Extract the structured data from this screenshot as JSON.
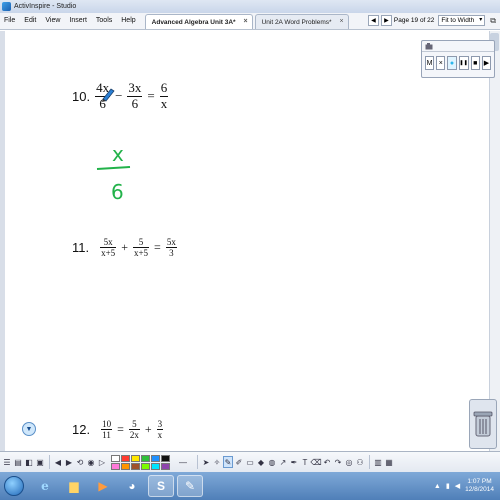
{
  "window": {
    "title": "ActivInspire - Studio"
  },
  "menu": [
    "File",
    "Edit",
    "View",
    "Insert",
    "Tools",
    "Help"
  ],
  "tabs": [
    {
      "label": "Advanced Algebra Unit 3A*",
      "active": true
    },
    {
      "label": "Unit 2A Word Problems*",
      "active": false
    }
  ],
  "pager": {
    "page_text": "Page 19 of 22",
    "fit": "Fit to Width"
  },
  "problems": {
    "p10": {
      "num": "10.",
      "t1": {
        "num": "4x",
        "den": "6"
      },
      "op1": "−",
      "t2": {
        "num": "3x",
        "den": "6"
      },
      "op2": "=",
      "t3": {
        "num": "6",
        "den": "x"
      }
    },
    "p11": {
      "num": "11.",
      "t1": {
        "num": "5x",
        "den": "x+5"
      },
      "op1": "+",
      "t2": {
        "num": "5",
        "den": "x+5"
      },
      "op2": "=",
      "t3": {
        "num": "5x",
        "den": "3"
      }
    },
    "p12": {
      "num": "12.",
      "t1": {
        "num": "10",
        "den": "11"
      },
      "op1": "=",
      "t2": {
        "num": "5",
        "den": "2x"
      },
      "op2": "+",
      "t3": {
        "num": "3",
        "den": "x"
      }
    }
  },
  "handwriting": {
    "num": "x",
    "den": "6",
    "color": "#22b24a"
  },
  "mini_toolbar": {
    "buttons": [
      "M",
      "×",
      "●",
      "❚❚",
      "■",
      "▶"
    ]
  },
  "palette": [
    "#ffffff",
    "#ff3b30",
    "#ffe600",
    "#2fbf3a",
    "#1e90ff",
    "#111111",
    "#ff7ad9",
    "#ff9500",
    "#a0522d",
    "#7cfc00",
    "#00e5ff",
    "#8e44ad"
  ],
  "taskbar": {
    "clock_time": "1:07 PM",
    "clock_date": "12/8/2014",
    "apps": [
      "internet-explorer",
      "file-explorer",
      "media-player",
      "chrome",
      "skype",
      "activinspire"
    ]
  },
  "colors": {
    "accent": "#1e6bc2",
    "ink": "#22b24a"
  }
}
